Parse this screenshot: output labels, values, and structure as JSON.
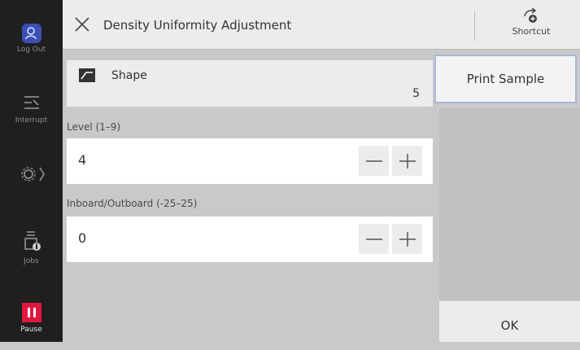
{
  "sidebar": {
    "logout_label": "Log Out",
    "interrupt_label": "Interrupt",
    "jobs_label": "Jobs",
    "pause_label": "Pause",
    "pause_color": "#e0173e"
  },
  "header": {
    "title": "Density Uniformity Adjustment",
    "shortcut_label": "Shortcut"
  },
  "shape": {
    "label": "Shape",
    "value": "5"
  },
  "level": {
    "label": "Level (1–9)",
    "value": "4"
  },
  "inboard": {
    "label": "Inboard/Outboard (-25–25)",
    "value": "0"
  },
  "actions": {
    "print_sample": "Print Sample",
    "ok": "OK"
  }
}
